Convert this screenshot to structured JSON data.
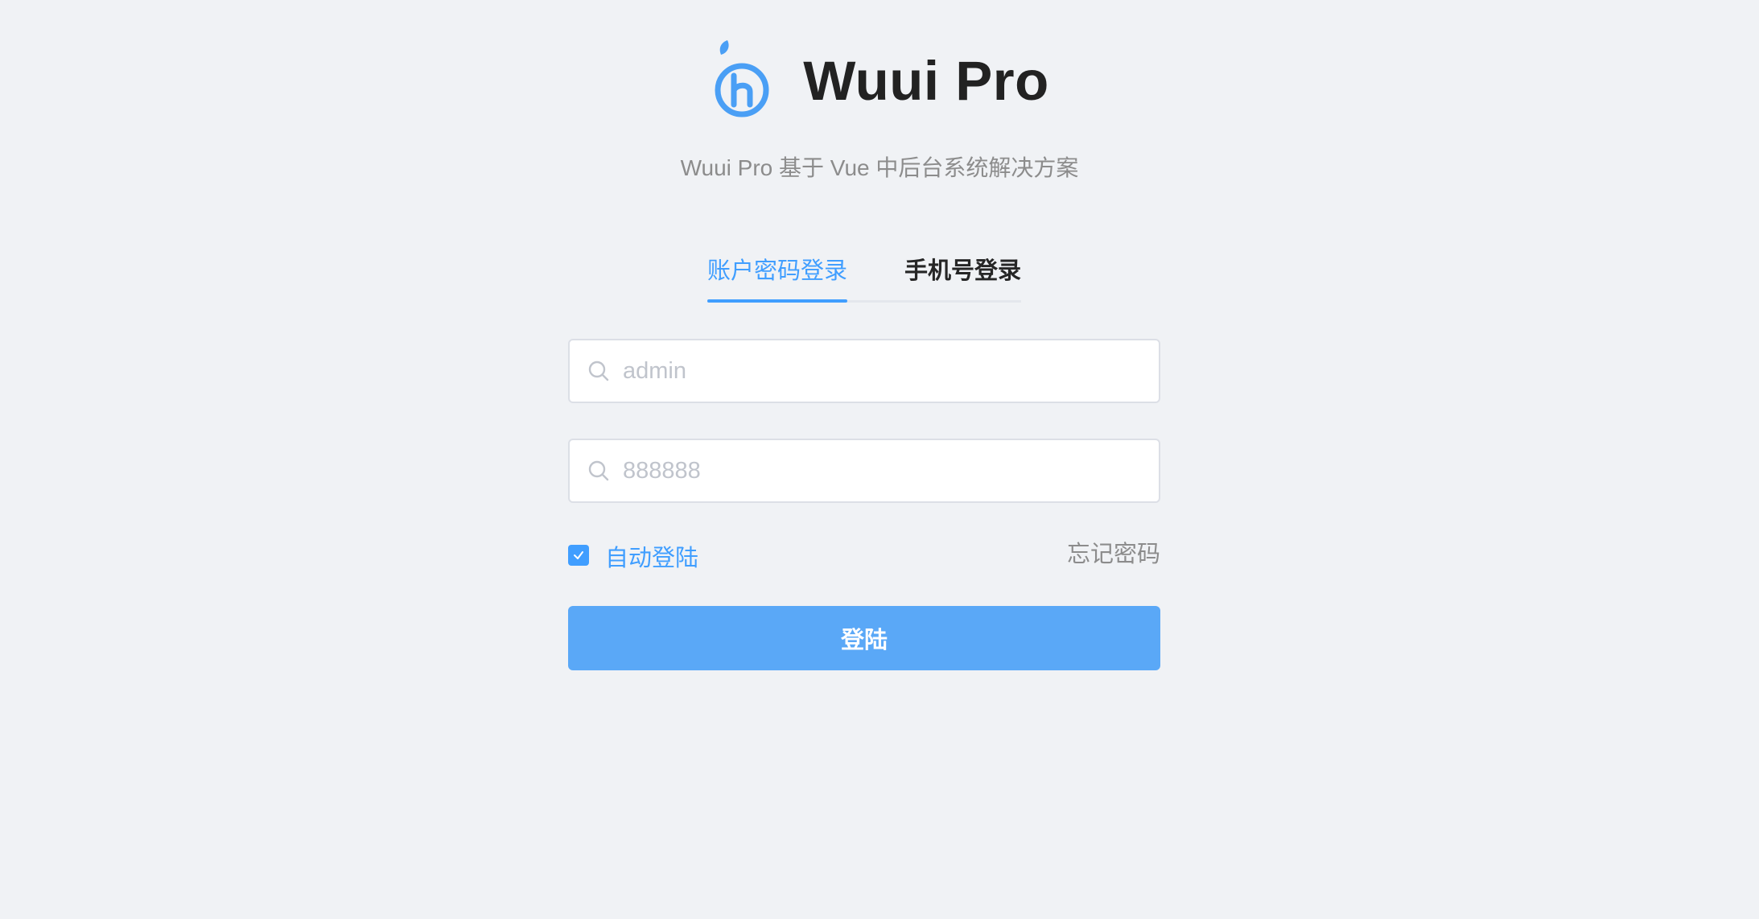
{
  "brand": {
    "name": "Wuui Pro",
    "subtitle": "Wuui Pro 基于 Vue 中后台系统解决方案",
    "logo_icon": "h-leaf-logo-icon",
    "accent_color": "#409eff"
  },
  "tabs": [
    {
      "label": "账户密码登录",
      "active": true
    },
    {
      "label": "手机号登录",
      "active": false
    }
  ],
  "form": {
    "username": {
      "placeholder": "admin",
      "value": "",
      "icon": "search-icon"
    },
    "password": {
      "placeholder": "888888",
      "value": "",
      "icon": "search-icon"
    },
    "remember": {
      "label": "自动登陆",
      "checked": true
    },
    "forgot_label": "忘记密码",
    "submit_label": "登陆",
    "submit_color": "#5aa8f7"
  }
}
